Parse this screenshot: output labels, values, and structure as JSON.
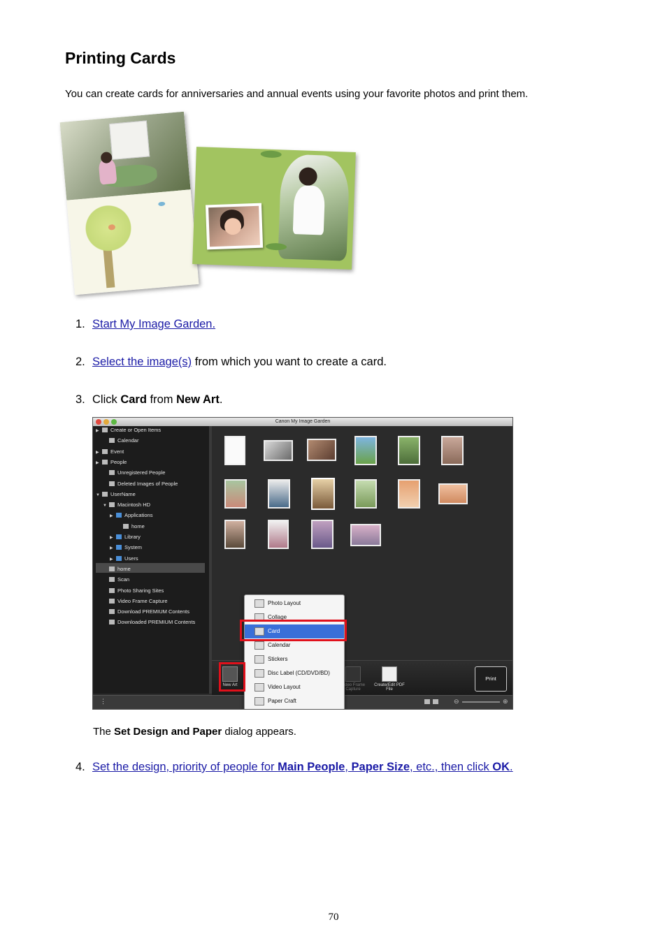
{
  "page": {
    "title": "Printing Cards",
    "intro": "You can create cards for anniversaries and annual events using your favorite photos and print them.",
    "page_number": "70"
  },
  "steps": [
    {
      "num": "1.",
      "link": "Start My Image Garden.",
      "rest": ""
    },
    {
      "num": "2.",
      "link": "Select the image(s)",
      "rest": " from which you want to create a card."
    },
    {
      "num": "3.",
      "prefix": "Click ",
      "bold1": "Card",
      "middle": " from ",
      "bold2": "New Art",
      "suffix": "."
    },
    {
      "num": "4.",
      "link_a": "Set the design, priority of people for ",
      "bold_a": "Main People",
      "link_b": ", ",
      "bold_b": "Paper Size",
      "link_c": ", etc., then click ",
      "bold_c": "OK",
      "link_d": "."
    }
  ],
  "note": {
    "prefix": "The ",
    "bold": "Set Design and Paper",
    "suffix": " dialog appears."
  },
  "app": {
    "window_title": "Canon My Image Garden",
    "sidebar": [
      {
        "label": "Create or Open Items",
        "icon": "create-icon",
        "tri": "▶"
      },
      {
        "label": "Calendar",
        "icon": "calendar-icon",
        "tri": ""
      },
      {
        "label": "Event",
        "icon": "event-icon",
        "tri": "▶"
      },
      {
        "label": "People",
        "icon": "people-icon",
        "tri": "▶"
      },
      {
        "label": "Unregistered People",
        "icon": "person-icon",
        "tri": ""
      },
      {
        "label": "Deleted Images of People",
        "icon": "person-icon",
        "tri": ""
      },
      {
        "label": "UserName",
        "icon": "user-icon",
        "tri": "▼"
      },
      {
        "label": "Macintosh HD",
        "icon": "drive-icon",
        "tri": "▼"
      },
      {
        "label": "Applications",
        "icon": "folder-icon",
        "tri": "▶"
      },
      {
        "label": "home",
        "icon": "home-icon",
        "tri": ""
      },
      {
        "label": "Library",
        "icon": "folder-icon",
        "tri": "▶"
      },
      {
        "label": "System",
        "icon": "folder-icon",
        "tri": "▶"
      },
      {
        "label": "Users",
        "icon": "folder-icon",
        "tri": "▶"
      },
      {
        "label": "home",
        "icon": "home-icon",
        "tri": ""
      },
      {
        "label": "Scan",
        "icon": "scan-icon",
        "tri": ""
      },
      {
        "label": "Photo Sharing Sites",
        "icon": "share-icon",
        "tri": ""
      },
      {
        "label": "Video Frame Capture",
        "icon": "video-icon",
        "tri": ""
      },
      {
        "label": "Download PREMIUM Contents",
        "icon": "download-icon",
        "tri": ""
      },
      {
        "label": "Downloaded PREMIUM Contents",
        "icon": "downloaded-icon",
        "tri": ""
      }
    ],
    "menu": [
      "Photo Layout",
      "Collage",
      "Card",
      "Calendar",
      "Stickers",
      "Disc Label (CD/DVD/BD)",
      "Video Layout",
      "Paper Craft"
    ],
    "menu_selected": "Card",
    "toolbar": {
      "new_art": "New Art",
      "video": "Video Frame Capture",
      "pdf": "Create/Edit PDF File",
      "print": "Print"
    },
    "colors": {
      "highlight": "#e0101b",
      "selection": "#3a6fd8",
      "link": "#1a1aa6"
    }
  }
}
